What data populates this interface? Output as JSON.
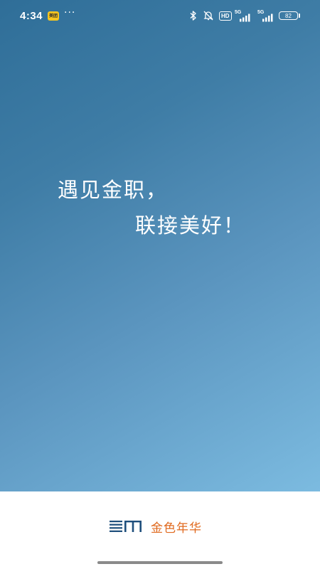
{
  "status_bar": {
    "time": "4:34",
    "app_badge": "美团",
    "more": "···",
    "hd": "HD",
    "network_1": "5G",
    "network_2": "5G",
    "battery": "82"
  },
  "splash": {
    "slogan_line1": "遇见金职，",
    "slogan_line2": "联接美好！"
  },
  "footer": {
    "brand_name": "金色年华",
    "brand_logo": "jinse-nianhua-logo",
    "brand_color": "#e06a1f",
    "logo_color": "#1f4f7c"
  },
  "theme": {
    "gradient_start": "#2f6e98",
    "gradient_end": "#7cbbe0"
  }
}
